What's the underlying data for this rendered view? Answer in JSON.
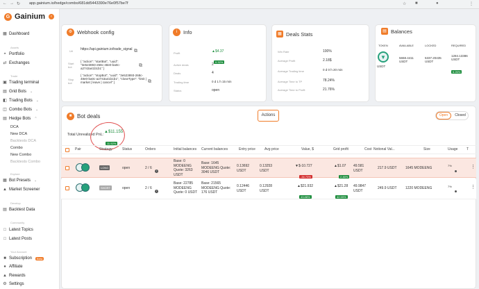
{
  "browser": {
    "url": "app.gainium.io/hedge/combo/681dd5443390e76e0f57be7f"
  },
  "app": {
    "name": "Gainium"
  },
  "sidebar": {
    "dashboard": "Dashboard",
    "sec_assets": "Assets",
    "portfolio": "Portfolio",
    "exchanges": "Exchanges",
    "sec_trade": "Trade",
    "trading_terminal": "Trading terminal",
    "grid_bots": "Grid Bots",
    "trading_bots": "Trading Bots",
    "combo_bots": "Combo Bots",
    "hedge_bots": "Hedge Bots",
    "sub_dca": "DCA",
    "sub_new_dca": "New DCA",
    "sub_backtest_dca": "Backtests DCA",
    "sub_combo": "Combo",
    "sub_new_combo": "New Combo",
    "sub_backtest_combo": "Backtests Combo",
    "sec_explore": "Explore",
    "bot_presets": "Bot Presets",
    "market_screener": "Market Screener",
    "sec_develop": "Develop",
    "backtest_data": "Backtest Data",
    "sec_community": "Community",
    "latest_topics": "Latest Topics",
    "latest_posts": "Latest Posts",
    "sec_account": "Your Account",
    "subscription": "Subscription",
    "subscription_badge": "Beta",
    "affiliate": "Affiliate",
    "rewards": "Rewards",
    "settings": "Settings"
  },
  "webhook": {
    "title": "Webhook config",
    "url_label": "Url",
    "url_value": "https://api.gainium.io/trade_signal",
    "start_label": "Start bot",
    "start_value": "{ \"action\": \"startBot\", \"uuid\": \"3e523893-268c-48e0-ba0c-a2743a41b1b1\" }",
    "stop_label": "Stop bot",
    "stop_value": "{ \"action\": \"stopBot\", \"uuid\": \"3e523893-268c-48e0-ba0c-a2743a41b1b1\", \"closeType\": \"limit | market | leave | cancel\" }"
  },
  "info": {
    "title": "Info",
    "profit_label": "Profit",
    "profit_value": "▲$4.37",
    "profit_pct": "0.32%",
    "active_label": "Active deals",
    "active_value": "2",
    "deals_label": "Deals",
    "deals_value": "4",
    "trading_time_label": "Trading time",
    "trading_time_value": "0 d 1 h 15 min",
    "status_label": "Status",
    "status_value": "open"
  },
  "deals_stats": {
    "title": "Deals Stats",
    "winrate_label": "Win Rate",
    "winrate_value": "100%",
    "avg_profit_label": "Average Profit",
    "avg_profit_value": "2.18$",
    "avg_trading_label": "Average Trading time",
    "avg_trading_value": "0 d 0 h 20 min",
    "avg_tp_label": "Average Time to TP",
    "avg_tp_value": "78.24%",
    "avg_profit2_label": "Average Time to Profit",
    "avg_profit2_value": "21.76%"
  },
  "balances": {
    "title": "Balances",
    "col_token": "TOKEN",
    "col_available": "AVAILABLE",
    "col_locked": "LOCKED",
    "col_required": "REQUIRED",
    "token": "USDT",
    "available": "5658.4411 USDT",
    "locked": "5337.20435 USDT",
    "required": "1284.13386 USDT",
    "required_pct": "6.26%"
  },
  "bot_deals": {
    "title": "Bot deals",
    "actions_label": "Actions",
    "tab_open": "Open",
    "tab_closed": "Closed",
    "unrealized_label": "Total Unrealized PnL:",
    "unrealized_value": "▲$11.155",
    "unrealized_pct": "11.92%",
    "columns": [
      "Pair",
      "Strategy",
      "Status",
      "Orders",
      "Initial balances",
      "Current balances",
      "Entry price",
      "Avg price",
      "Value, $",
      "Grid profit",
      "Cost",
      "Notional Val...",
      "Size",
      "Usage",
      "T"
    ],
    "rows": [
      {
        "strategy": "LONG",
        "status": "open",
        "orders": "2 / 6",
        "initial": "Base: 0 MODEENG Quote: 3263 USDT",
        "current": "Base: 1645 MODEENG Quote: 3046 USDT",
        "entry": "0.13692 USDT",
        "avg": "0.13253 USDT",
        "value": "▼$-10.727",
        "value_pct": "-34.73%",
        "grid": "▲$1.07",
        "grid_pct": "2.46%",
        "cost": "49.581 USDT",
        "notional": "217.9 USDT",
        "size": "1645 MODEENG",
        "usage": "7%"
      },
      {
        "strategy": "SHORT",
        "status": "open",
        "orders": "2 / 6",
        "initial": "Base: 22785 MODEENG Quote: 0 USDT",
        "current": "Base: 21565 MODEENG Quote: 176 USDT",
        "entry": "0.12446 USDT",
        "avg": "0.12928 USDT",
        "value": "▲$21.932",
        "value_pct": "43.88%",
        "grid": "▲$21.28",
        "grid_pct": "42.59%",
        "cost": "49.9847 USDT",
        "notional": "249.9 USDT",
        "size": "1220 MODEENG",
        "usage": "7%"
      }
    ]
  }
}
